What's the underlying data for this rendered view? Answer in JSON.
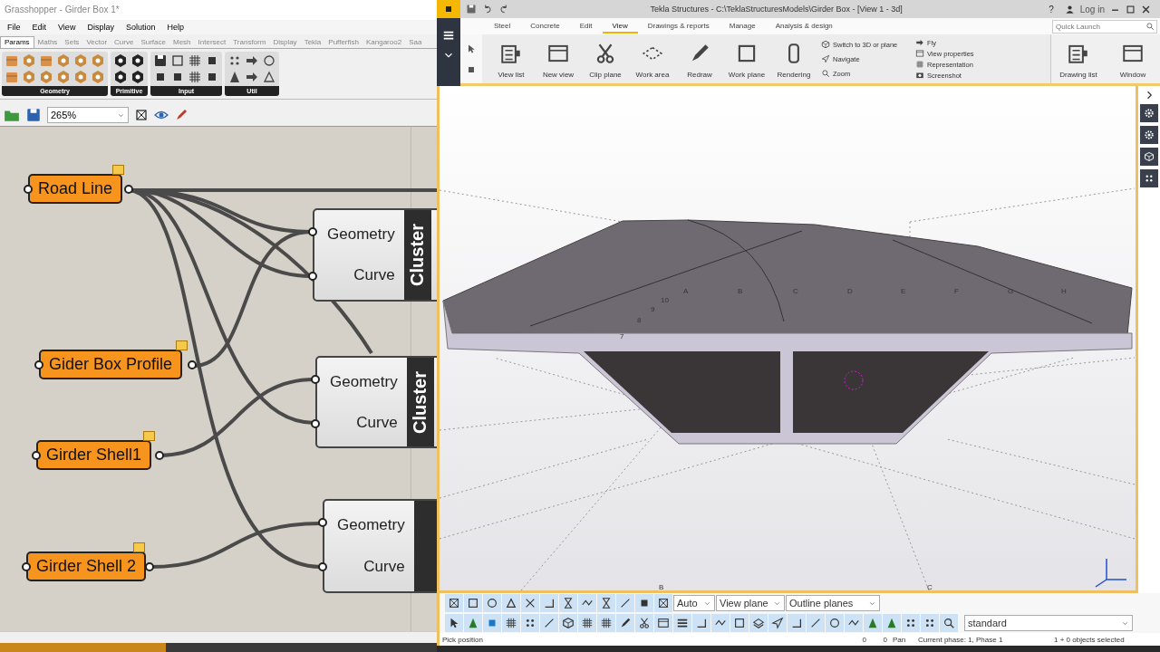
{
  "grasshopper": {
    "title": "Grasshopper - Girder Box 1*",
    "menu": [
      "File",
      "Edit",
      "View",
      "Display",
      "Solution",
      "Help"
    ],
    "tabs": [
      {
        "label": "Params",
        "selected": true
      },
      {
        "label": "Maths",
        "selected": false
      },
      {
        "label": "Sets",
        "selected": false
      },
      {
        "label": "Vector",
        "selected": false
      },
      {
        "label": "Curve",
        "selected": false
      },
      {
        "label": "Surface",
        "selected": false
      },
      {
        "label": "Mesh",
        "selected": false
      },
      {
        "label": "Intersect",
        "selected": false
      },
      {
        "label": "Transform",
        "selected": false
      },
      {
        "label": "Display",
        "selected": false
      },
      {
        "label": "Tekla",
        "selected": false
      },
      {
        "label": "Pufferfish",
        "selected": false
      },
      {
        "label": "Kangaroo2",
        "selected": false
      },
      {
        "label": "Saa",
        "selected": false
      }
    ],
    "palette_groups": [
      "Geometry",
      "Primitive",
      "Input",
      "Util"
    ],
    "zoom": "265%",
    "progress": {
      "level": 0.38
    },
    "params": [
      {
        "label": "Road Line"
      },
      {
        "label": "Gider Box Profile"
      },
      {
        "label": "Girder Shell1"
      },
      {
        "label": "Girder Shell 2"
      }
    ],
    "clusters": [
      {
        "inputs": [
          "Geometry",
          "Curve"
        ],
        "label": "Cluster"
      },
      {
        "inputs": [
          "Geometry",
          "Curve"
        ],
        "label": "Cluster"
      },
      {
        "inputs": [
          "Geometry",
          "Curve"
        ]
      }
    ]
  },
  "tekla": {
    "title": "Tekla Structures - C:\\TeklaStructuresModels\\Girder Box  - [View 1 - 3d]",
    "help": "?",
    "login": "Log in",
    "tabs": [
      {
        "label": "Steel",
        "selected": false
      },
      {
        "label": "Concrete",
        "selected": false
      },
      {
        "label": "Edit",
        "selected": false
      },
      {
        "label": "View",
        "selected": true
      },
      {
        "label": "Drawings & reports",
        "selected": false
      },
      {
        "label": "Manage",
        "selected": false
      },
      {
        "label": "Analysis & design",
        "selected": false
      }
    ],
    "quick_launch": {
      "placeholder": "Quick Launch"
    },
    "ribbon_buttons": [
      "View list",
      "New view",
      "Clip plane",
      "Work area",
      "Redraw",
      "Work plane",
      "Rendering"
    ],
    "ribbon_small": [
      "Switch to 3D or plane",
      "Navigate",
      "Zoom",
      "Fly",
      "View properties",
      "Representation",
      "Screenshot"
    ],
    "ribbon_right": [
      "Drawing list",
      "Window"
    ],
    "grid_labels_top": [
      "A",
      "B",
      "C",
      "D",
      "E",
      "F",
      "G",
      "H"
    ],
    "grid_labels_side": [
      "10",
      "9",
      "8",
      "7"
    ],
    "grid_labels_bottom": [
      "B",
      "C"
    ],
    "dropdowns": [
      "Auto",
      "View plane",
      "Outline planes"
    ],
    "filter": "standard",
    "status": [
      "Pick position",
      "0",
      "0",
      "Pan",
      "Current phase: 1, Phase 1",
      "1 + 0 objects selected"
    ]
  }
}
